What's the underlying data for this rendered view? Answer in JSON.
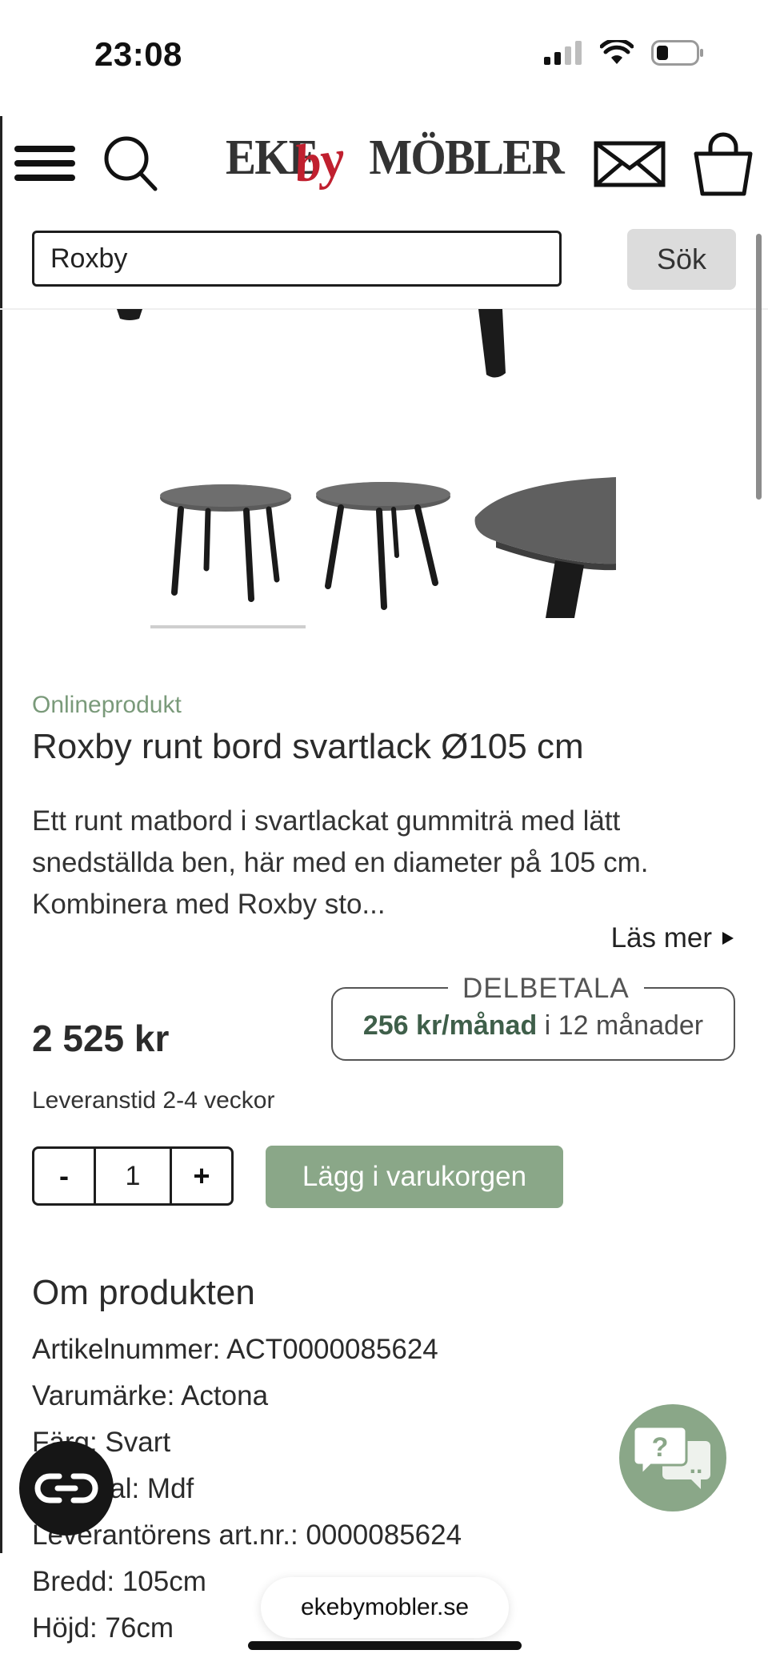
{
  "status_bar": {
    "time": "23:08"
  },
  "header": {
    "brand_eke": "EKE",
    "brand_by": "by",
    "brand_mobler": "MÖBLER"
  },
  "search": {
    "value": "Roxby",
    "button_label": "Sök"
  },
  "product": {
    "tag": "Onlineprodukt",
    "title": "Roxby runt bord svartlack Ø105 cm",
    "description": "Ett runt matbord i svartlackat gummiträ med lätt snedställda ben, här med en diameter på 105 cm. Kombinera med Roxby sto...",
    "read_more": "Läs mer",
    "price": "2 525 kr",
    "installment_label": "DELBETALA",
    "installment_amount": "256 kr/månad",
    "installment_term": "i 12 månader",
    "delivery": "Leveranstid 2-4 veckor",
    "quantity": "1",
    "qty_minus": "-",
    "qty_plus": "+",
    "add_to_cart": "Lägg i varukorgen"
  },
  "about": {
    "title": "Om produkten",
    "specs": [
      "Artikelnummer: ACT0000085624",
      "Varumärke: Actona",
      "Färg: Svart",
      "Material: Mdf",
      "Leverantörens art.nr.: 0000085624",
      "Bredd: 105cm",
      "Höjd: 76cm"
    ]
  },
  "chat": {
    "question_mark": "?",
    "dots": ".."
  },
  "browser": {
    "url": "ekebymobler.se"
  },
  "colors": {
    "accent_green": "#8aa788",
    "brand_red": "#c0202f",
    "text_dark": "#2b2b2b"
  },
  "icons": [
    "hamburger-menu-icon",
    "search-icon",
    "mail-icon",
    "shopping-bag-icon",
    "triangle-right-icon",
    "chat-bubbles-icon",
    "cookie-consent-icon"
  ]
}
